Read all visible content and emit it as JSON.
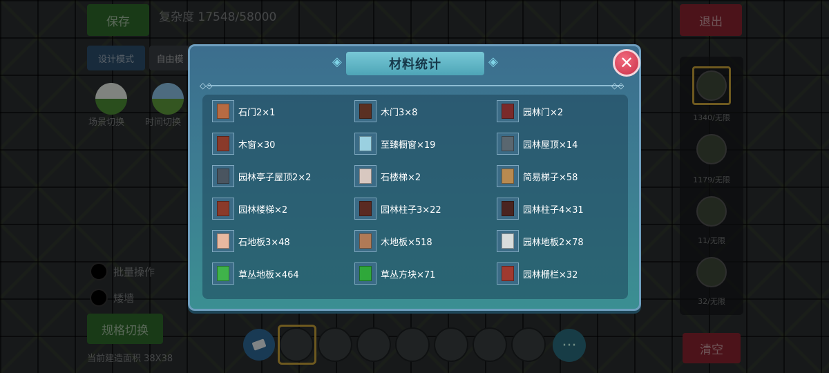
{
  "hud": {
    "save_label": "保存",
    "complexity_text": "复杂度 17548/58000",
    "exit_label": "退出",
    "design_mode_label": "设计模式",
    "free_label": "自由模",
    "scene_switch_label": "场景切换",
    "time_switch_label": "时间切换",
    "batch_label": "批量操作",
    "wall_label": "矮墙",
    "spec_switch_label": "规格切换",
    "area_label": "当前建造面积 38X38",
    "clear_label": "清空",
    "right_panel": [
      {
        "count": "1340/无限",
        "icon": "window-icon"
      },
      {
        "count": "1179/无限",
        "icon": "grid-icon"
      },
      {
        "count": "11/无限",
        "icon": "door-icon"
      },
      {
        "count": "32/无限",
        "icon": "fence-icon"
      }
    ],
    "more_label": "···"
  },
  "dialog": {
    "title": "材料统计",
    "close_glyph": "✕",
    "items": [
      {
        "label": "石门2×1",
        "icon": "stone-door-icon",
        "color": "#b76b43"
      },
      {
        "label": "木门3×8",
        "icon": "wood-door-icon",
        "color": "#5a3022"
      },
      {
        "label": "园林门×2",
        "icon": "garden-door-icon",
        "color": "#7a2a2a"
      },
      {
        "label": "木窗×30",
        "icon": "wood-window-icon",
        "color": "#8a3a2a"
      },
      {
        "label": "至臻橱窗×19",
        "icon": "display-window-icon",
        "color": "#9ad0e0"
      },
      {
        "label": "园林屋顶×14",
        "icon": "garden-roof-icon",
        "color": "#5a6770"
      },
      {
        "label": "园林亭子屋顶2×2",
        "icon": "pavilion-roof-icon",
        "color": "#4a5560"
      },
      {
        "label": "石楼梯×2",
        "icon": "stone-stairs-icon",
        "color": "#d8c8c0"
      },
      {
        "label": "简易梯子×58",
        "icon": "ladder-icon",
        "color": "#b88a50"
      },
      {
        "label": "园林楼梯×2",
        "icon": "garden-stairs-icon",
        "color": "#8a3a2a"
      },
      {
        "label": "园林柱子3×22",
        "icon": "garden-pillar-icon",
        "color": "#5a2a22"
      },
      {
        "label": "园林柱子4×31",
        "icon": "garden-pillar-tall-icon",
        "color": "#4a2420"
      },
      {
        "label": "石地板3×48",
        "icon": "stone-floor-icon",
        "color": "#e8b8a0"
      },
      {
        "label": "木地板×518",
        "icon": "wood-floor-icon",
        "color": "#b07a56"
      },
      {
        "label": "园林地板2×78",
        "icon": "garden-floor-icon",
        "color": "#d8dcdc"
      },
      {
        "label": "草丛地板×464",
        "icon": "grass-floor-icon",
        "color": "#3fb34a"
      },
      {
        "label": "草丛方块×71",
        "icon": "grass-block-icon",
        "color": "#2fa83a"
      },
      {
        "label": "园林栅栏×32",
        "icon": "garden-fence-icon",
        "color": "#a03a30"
      }
    ]
  }
}
